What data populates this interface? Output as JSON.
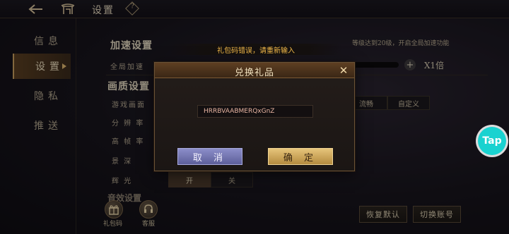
{
  "header": {
    "title": "设置",
    "help_symbol": "?"
  },
  "nav": {
    "items": [
      {
        "label": "信息"
      },
      {
        "label": "设置"
      },
      {
        "label": "隐私"
      },
      {
        "label": "推送"
      }
    ]
  },
  "speed": {
    "section_title": "加速设置",
    "hint": "等级达到20级，开启全局加速功能",
    "row_label": "全局加速",
    "plus": "+",
    "value": "X1倍"
  },
  "quality": {
    "section_title": "画质设置",
    "rows": [
      "游戏画面",
      "分 辨 率",
      "高 帧 率",
      "景 深",
      "辉 光"
    ],
    "options": [
      "流畅",
      "自定义"
    ]
  },
  "glow_toggle": {
    "on": "开",
    "off": "关"
  },
  "partial_section": "音效设置",
  "bottom": {
    "gift_label": "礼包码",
    "service_label": "客服",
    "restore_default": "恢复默认",
    "switch_account": "切换账号"
  },
  "toast": "礼包码错误，请重新输入",
  "dialog": {
    "title": "兑换礼品",
    "code_value": "HRRBVAABMERQxGnZ",
    "cancel": "取 消",
    "confirm": "确 定",
    "close": "✕"
  },
  "floating": {
    "tap": "Tap"
  },
  "colors": {
    "accent_gold": "#e6c47a",
    "cancel_blue": "#8c8ec9",
    "tap_cyan": "#19d2d0",
    "toast_orange": "#f2b94a"
  }
}
